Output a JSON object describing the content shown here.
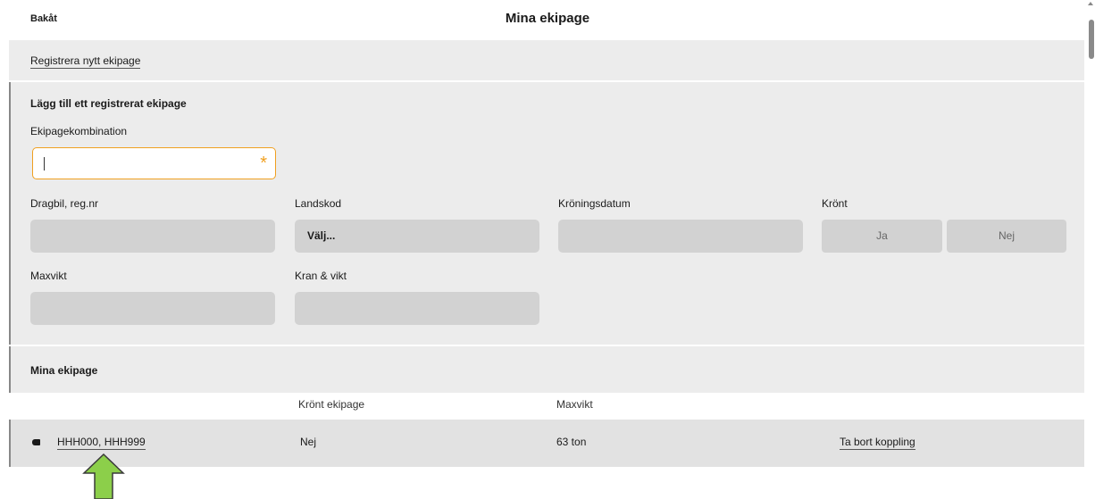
{
  "header": {
    "back_label": "Bakåt",
    "title": "Mina ekipage"
  },
  "register": {
    "link_label": "Registrera nytt ekipage"
  },
  "add_form": {
    "title": "Lägg till ett registrerat ekipage",
    "combination_label": "Ekipagekombination",
    "combination_value": "",
    "required_marker": "*",
    "tractor_label": "Dragbil, reg.nr",
    "country_label": "Landskod",
    "country_selected": "Välj...",
    "crowning_date_label": "Kröningsdatum",
    "crowned_label": "Krönt",
    "crowned_yes": "Ja",
    "crowned_no": "Nej",
    "max_weight_label": "Maxvikt",
    "crane_label": "Kran & vikt"
  },
  "list": {
    "title": "Mina ekipage",
    "columns": [
      "Krönt ekipage",
      "Maxvikt"
    ],
    "rows": [
      {
        "icon": "truck-icon",
        "name": "HHH000, HHH999",
        "crowned": "Nej",
        "max_weight": "63 ton",
        "action": "Ta bort koppling"
      }
    ]
  },
  "colors": {
    "accent": "#f0a020",
    "panel": "#ececec",
    "field": "#d2d2d2",
    "annotation_arrow": "#8ccf4a"
  }
}
